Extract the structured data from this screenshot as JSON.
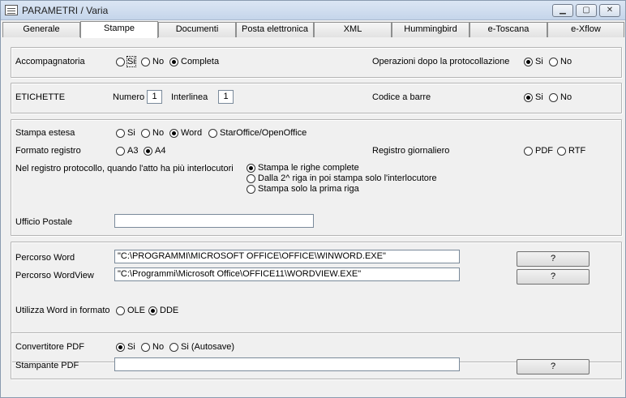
{
  "window": {
    "title": "PARAMETRI / Varia"
  },
  "tabs": [
    "Generale",
    "Stampe",
    "Documenti",
    "Posta elettronica",
    "XML",
    "Hummingbird",
    "e-Toscana",
    "e-Xflow"
  ],
  "active_tab": "Stampe",
  "accompagnatoria": {
    "label": "Accompagnatoria",
    "options": [
      "Si",
      "No",
      "Completa"
    ],
    "selected": "Completa"
  },
  "operazioni": {
    "label": "Operazioni dopo la protocollazione",
    "options": [
      "Si",
      "No"
    ],
    "selected": "Si"
  },
  "etichette": {
    "label": "ETICHETTE",
    "numero_label": "Numero",
    "numero_value": "1",
    "interlinea_label": "Interlinea",
    "interlinea_value": "1"
  },
  "codice_barre": {
    "label": "Codice a barre",
    "options": [
      "Si",
      "No"
    ],
    "selected": "Si"
  },
  "stampa_estesa": {
    "label": "Stampa estesa",
    "options": [
      "Si",
      "No",
      "Word",
      "StarOffice/OpenOffice"
    ],
    "selected": "Word"
  },
  "formato_registro": {
    "label": "Formato registro",
    "options": [
      "A3",
      "A4"
    ],
    "selected": "A4"
  },
  "registro_giornaliero": {
    "label": "Registro giornaliero",
    "options": [
      "PDF",
      "RTF"
    ],
    "selected": ""
  },
  "registro_interlocutori": {
    "label": "Nel registro protocollo, quando l'atto ha più interlocutori",
    "options": [
      "Stampa le righe complete",
      "Dalla 2^ riga in poi stampa solo l'interlocutore",
      "Stampa solo la prima riga"
    ],
    "selected": "Stampa le righe complete"
  },
  "ufficio_postale": {
    "label": "Ufficio Postale",
    "value": ""
  },
  "percorso_word": {
    "label": "Percorso Word",
    "value": "\"C:\\PROGRAMMI\\MICROSOFT OFFICE\\OFFICE\\WINWORD.EXE\"",
    "button": "?"
  },
  "percorso_wordview": {
    "label": "Percorso WordView",
    "value": "\"C:\\Programmi\\Microsoft Office\\OFFICE11\\WORDVIEW.EXE\"",
    "button": "?"
  },
  "utilizza_word": {
    "label": "Utilizza Word in formato",
    "options": [
      "OLE",
      "DDE"
    ],
    "selected": "DDE"
  },
  "convertitore_pdf": {
    "label": "Convertitore PDF",
    "options": [
      "Si",
      "No",
      "Si (Autosave)"
    ],
    "selected": "Si"
  },
  "stampante_pdf": {
    "label": "Stampante PDF",
    "value": "",
    "button": "?"
  }
}
